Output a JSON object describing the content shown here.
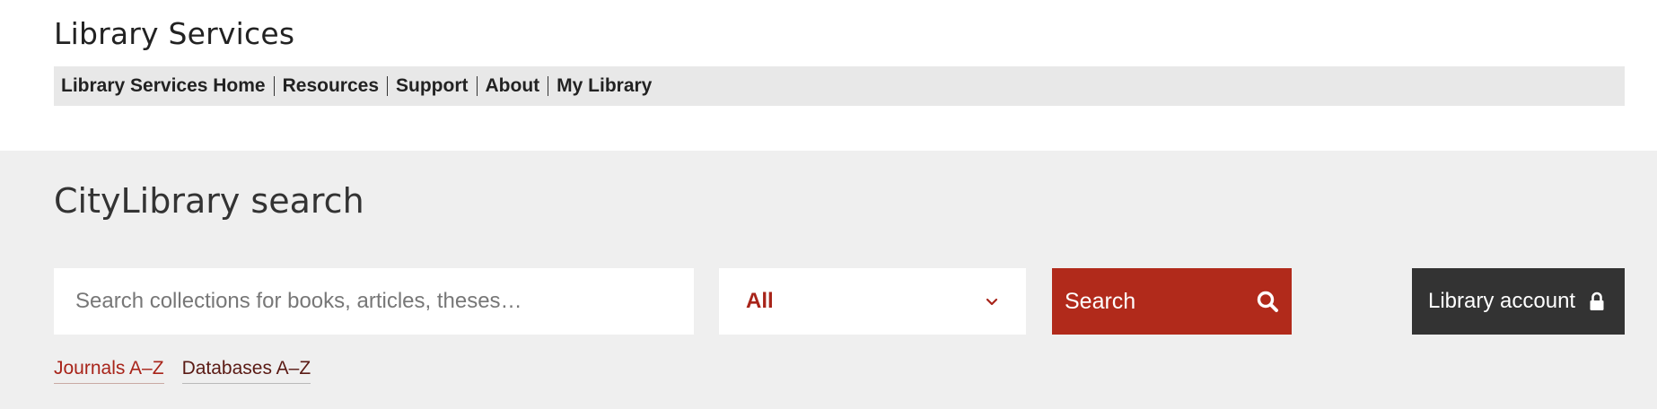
{
  "header": {
    "site_title": "Library Services",
    "nav": [
      {
        "label": "Library Services Home"
      },
      {
        "label": "Resources"
      },
      {
        "label": "Support"
      },
      {
        "label": "About"
      },
      {
        "label": "My Library"
      }
    ]
  },
  "search": {
    "heading": "CityLibrary search",
    "input_placeholder": "Search collections for books, articles, theses…",
    "input_value": "",
    "scope_selected": "All",
    "search_label": "Search",
    "account_label": "Library account",
    "links": [
      {
        "label": "Journals A–Z"
      },
      {
        "label": "Databases A–Z"
      }
    ]
  },
  "colors": {
    "accent_red": "#b12a1b",
    "dark_button": "#333333",
    "panel_bg": "#efefef",
    "nav_bg": "#e8e8e8"
  },
  "icons": {
    "search": "magnifier-icon",
    "lock": "lock-icon",
    "dropdown": "chevron-down-icon"
  }
}
